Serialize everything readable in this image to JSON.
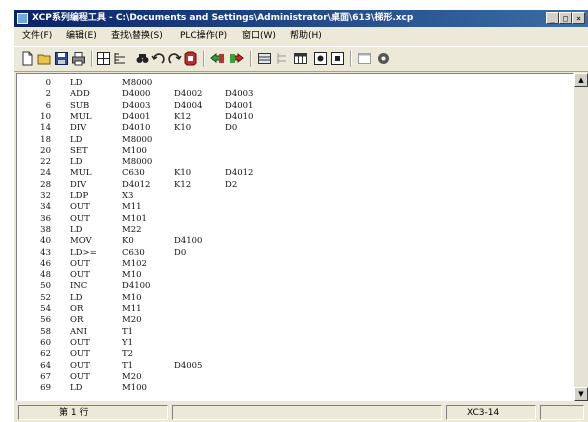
{
  "window": {
    "title": "XCP系列编程工具 - C:\\Documents and Settings\\Administrator\\桌面\\613\\梯形.xcp",
    "buttons": [
      "_",
      "□",
      "×"
    ]
  },
  "menu": [
    "文件(F)",
    "编辑(E)",
    "查找\\替换(S)",
    "PLC操作(P)",
    "窗口(W)",
    "帮助(H)"
  ],
  "toolbar_icons": [
    "new-file-icon",
    "open-folder-icon",
    "save-icon",
    "print-icon",
    "ladder-view-icon",
    "instruction-list-icon",
    "find-icon",
    "undo-icon",
    "redo-icon",
    "monitor-icon",
    "upload-icon",
    "download-icon",
    "grid-icon",
    "tree-icon",
    "table-icon",
    "run-icon",
    "stop-icon",
    "window-icon",
    "settings-icon"
  ],
  "program": [
    {
      "n": "0",
      "ins": "LD",
      "ops": [
        "M8000"
      ]
    },
    {
      "n": "2",
      "ins": "ADD",
      "ops": [
        "D4000",
        "D4002",
        "D4003"
      ]
    },
    {
      "n": "6",
      "ins": "SUB",
      "ops": [
        "D4003",
        "D4004",
        "D4001"
      ]
    },
    {
      "n": "10",
      "ins": "MUL",
      "ops": [
        "D4001",
        "K12",
        "D4010"
      ]
    },
    {
      "n": "14",
      "ins": "DIV",
      "ops": [
        "D4010",
        "K10",
        "D0"
      ]
    },
    {
      "n": "18",
      "ins": "LD",
      "ops": [
        "M8000"
      ]
    },
    {
      "n": "20",
      "ins": "SET",
      "ops": [
        "M100"
      ]
    },
    {
      "n": "22",
      "ins": "LD",
      "ops": [
        "M8000"
      ]
    },
    {
      "n": "24",
      "ins": "MUL",
      "ops": [
        "C630",
        "K10",
        "D4012"
      ]
    },
    {
      "n": "28",
      "ins": "DIV",
      "ops": [
        "D4012",
        "K12",
        "D2"
      ]
    },
    {
      "n": "32",
      "ins": "LDP",
      "ops": [
        "X3"
      ]
    },
    {
      "n": "34",
      "ins": "OUT",
      "ops": [
        "M11"
      ]
    },
    {
      "n": "36",
      "ins": "OUT",
      "ops": [
        "M101"
      ]
    },
    {
      "n": "38",
      "ins": "LD",
      "ops": [
        "M22"
      ]
    },
    {
      "n": "40",
      "ins": "MOV",
      "ops": [
        "K0",
        "D4100"
      ]
    },
    {
      "n": "43",
      "ins": "LD>=",
      "ops": [
        "C630",
        "D0"
      ]
    },
    {
      "n": "46",
      "ins": "OUT",
      "ops": [
        "M102"
      ]
    },
    {
      "n": "48",
      "ins": "OUT",
      "ops": [
        "M10"
      ]
    },
    {
      "n": "50",
      "ins": "INC",
      "ops": [
        "D4100"
      ]
    },
    {
      "n": "52",
      "ins": "LD",
      "ops": [
        "M10"
      ]
    },
    {
      "n": "54",
      "ins": "OR",
      "ops": [
        "M11"
      ]
    },
    {
      "n": "56",
      "ins": "OR",
      "ops": [
        "M20"
      ]
    },
    {
      "n": "58",
      "ins": "ANI",
      "ops": [
        "T1"
      ]
    },
    {
      "n": "60",
      "ins": "OUT",
      "ops": [
        "Y1"
      ]
    },
    {
      "n": "62",
      "ins": "OUT",
      "ops": [
        "T2"
      ]
    },
    {
      "n": "64",
      "ins": "OUT",
      "ops": [
        "T1",
        "D4005"
      ]
    },
    {
      "n": "67",
      "ins": "OUT",
      "ops": [
        "M20"
      ]
    },
    {
      "n": "69",
      "ins": "LD",
      "ops": [
        "M100"
      ]
    }
  ],
  "status": {
    "line": "第 1 行",
    "model": "XC3-14"
  }
}
